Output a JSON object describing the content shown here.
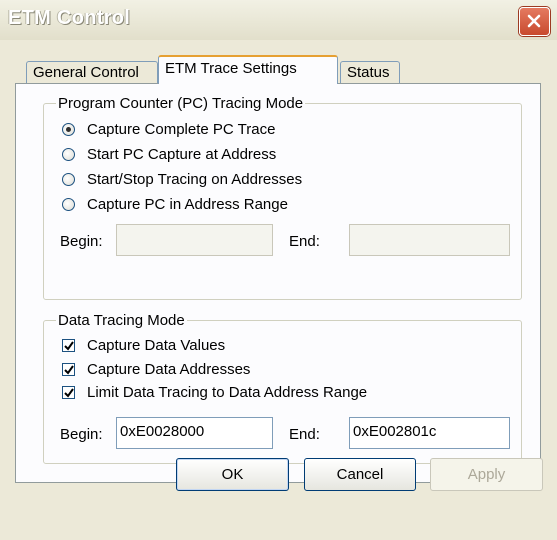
{
  "window": {
    "title": "ETM Control",
    "close_icon": "close-icon"
  },
  "tabs": [
    {
      "label": "General Control",
      "selected": false
    },
    {
      "label": "ETM Trace Settings",
      "selected": true
    },
    {
      "label": "Status",
      "selected": false
    }
  ],
  "pc_tracing": {
    "legend": "Program Counter (PC) Tracing Mode",
    "options": [
      {
        "label": "Capture Complete PC Trace",
        "selected": true
      },
      {
        "label": "Start PC Capture at Address",
        "selected": false
      },
      {
        "label": "Start/Stop Tracing on Addresses",
        "selected": false
      },
      {
        "label": "Capture PC in Address Range",
        "selected": false
      }
    ],
    "begin_label": "Begin:",
    "begin_value": "",
    "end_label": "End:",
    "end_value": ""
  },
  "data_tracing": {
    "legend": "Data Tracing Mode",
    "options": [
      {
        "label": "Capture Data Values",
        "checked": true
      },
      {
        "label": "Capture Data Addresses",
        "checked": true
      },
      {
        "label": "Limit Data Tracing to Data Address Range",
        "checked": true
      }
    ],
    "begin_label": "Begin:",
    "begin_value": "0xE0028000",
    "end_label": "End:",
    "end_value": "0xE002801c"
  },
  "buttons": {
    "ok": "OK",
    "cancel": "Cancel",
    "apply": "Apply"
  }
}
